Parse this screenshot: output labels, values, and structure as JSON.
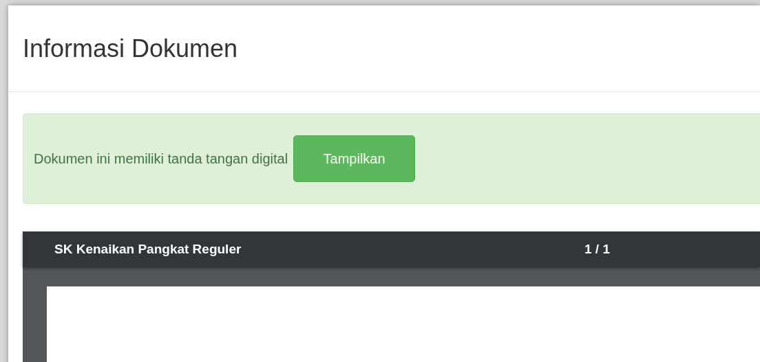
{
  "modal": {
    "title": "Informasi Dokumen"
  },
  "alert": {
    "message": "Dokumen ini memiliki tanda tangan digital",
    "button": "Tampilkan"
  },
  "viewer": {
    "document_title": "SK Kenaikan Pangkat Reguler",
    "page_indicator": "1 / 1"
  }
}
